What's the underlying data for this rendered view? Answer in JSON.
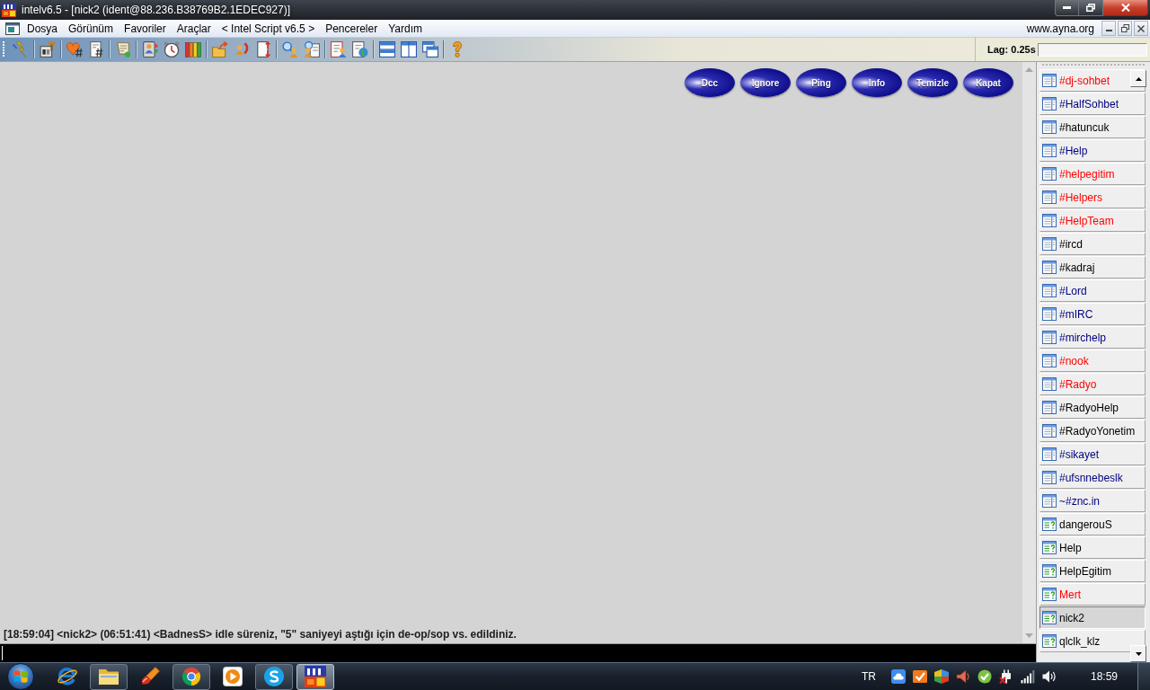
{
  "window": {
    "title": "intelv6.5 - [nick2 (ident@88.236.B38769B2.1EDEC927)]"
  },
  "menu_bar": {
    "items": [
      "Dosya",
      "Görünüm",
      "Favoriler",
      "Araçlar",
      "< Intel Script v6.5 >",
      "Pencereler",
      "Yardım"
    ],
    "site": "www.ayna.org"
  },
  "toolbar": {
    "lag": "Lag: 0.25s"
  },
  "channel_window": {
    "buttons": [
      "Dcc",
      "Ignore",
      "Ping",
      "Info",
      "Temizle",
      "Kapat"
    ],
    "messages": [
      "[18:59:04] <nick2> (06:51:41) <BadnesS> idle süreniz, \"5\" saniyeyi aştığı için de-op/sop vs. edildiniz."
    ]
  },
  "switchbar": {
    "items": [
      {
        "label": "#dj-sohbet",
        "kind": "channel",
        "color": "#ff0000",
        "selected": false
      },
      {
        "label": "#HalfSohbet",
        "kind": "channel",
        "color": "#000080",
        "selected": false
      },
      {
        "label": "#hatuncuk",
        "kind": "channel",
        "color": "#000000",
        "selected": false
      },
      {
        "label": "#Help",
        "kind": "channel",
        "color": "#000080",
        "selected": false
      },
      {
        "label": "#helpegitim",
        "kind": "channel",
        "color": "#ff0000",
        "selected": false
      },
      {
        "label": "#Helpers",
        "kind": "channel",
        "color": "#ff0000",
        "selected": false
      },
      {
        "label": "#HelpTeam",
        "kind": "channel",
        "color": "#ff0000",
        "selected": false
      },
      {
        "label": "#ircd",
        "kind": "channel",
        "color": "#000000",
        "selected": false
      },
      {
        "label": "#kadraj",
        "kind": "channel",
        "color": "#000000",
        "selected": false
      },
      {
        "label": "#Lord",
        "kind": "channel",
        "color": "#000080",
        "selected": false
      },
      {
        "label": "#mIRC",
        "kind": "channel",
        "color": "#000080",
        "selected": false
      },
      {
        "label": "#mirchelp",
        "kind": "channel",
        "color": "#000080",
        "selected": false
      },
      {
        "label": "#nook",
        "kind": "channel",
        "color": "#ff0000",
        "selected": false
      },
      {
        "label": "#Radyo",
        "kind": "channel",
        "color": "#ff0000",
        "selected": false
      },
      {
        "label": "#RadyoHelp",
        "kind": "channel",
        "color": "#000000",
        "selected": false
      },
      {
        "label": "#RadyoYonetim",
        "kind": "channel",
        "color": "#000000",
        "selected": false
      },
      {
        "label": "#sikayet",
        "kind": "channel",
        "color": "#000080",
        "selected": false
      },
      {
        "label": "#ufsnnebeslk",
        "kind": "channel",
        "color": "#000080",
        "selected": false
      },
      {
        "label": "~#znc.in",
        "kind": "channel",
        "color": "#000080",
        "selected": false
      },
      {
        "label": "dangerouS",
        "kind": "query",
        "color": "#000000",
        "selected": false
      },
      {
        "label": "Help",
        "kind": "query",
        "color": "#000000",
        "selected": false
      },
      {
        "label": "HelpEgitim",
        "kind": "query",
        "color": "#000000",
        "selected": false
      },
      {
        "label": "Mert",
        "kind": "query",
        "color": "#ff0000",
        "selected": false
      },
      {
        "label": "nick2",
        "kind": "query",
        "color": "#000000",
        "selected": true
      },
      {
        "label": "qlclk_klz",
        "kind": "query",
        "color": "#000000",
        "selected": false
      }
    ]
  },
  "taskbar": {
    "apps": [
      {
        "kind": "e-browser",
        "running": false,
        "selected": false
      },
      {
        "kind": "folder",
        "running": true,
        "selected": false
      },
      {
        "kind": "brush",
        "running": false,
        "selected": false
      },
      {
        "kind": "circle-browser",
        "running": true,
        "selected": false
      },
      {
        "kind": "player",
        "running": false,
        "selected": false
      },
      {
        "kind": "messenger",
        "running": true,
        "selected": false
      },
      {
        "kind": "irc-client",
        "running": true,
        "selected": true
      }
    ],
    "language": "TR",
    "clock": "18:59"
  }
}
